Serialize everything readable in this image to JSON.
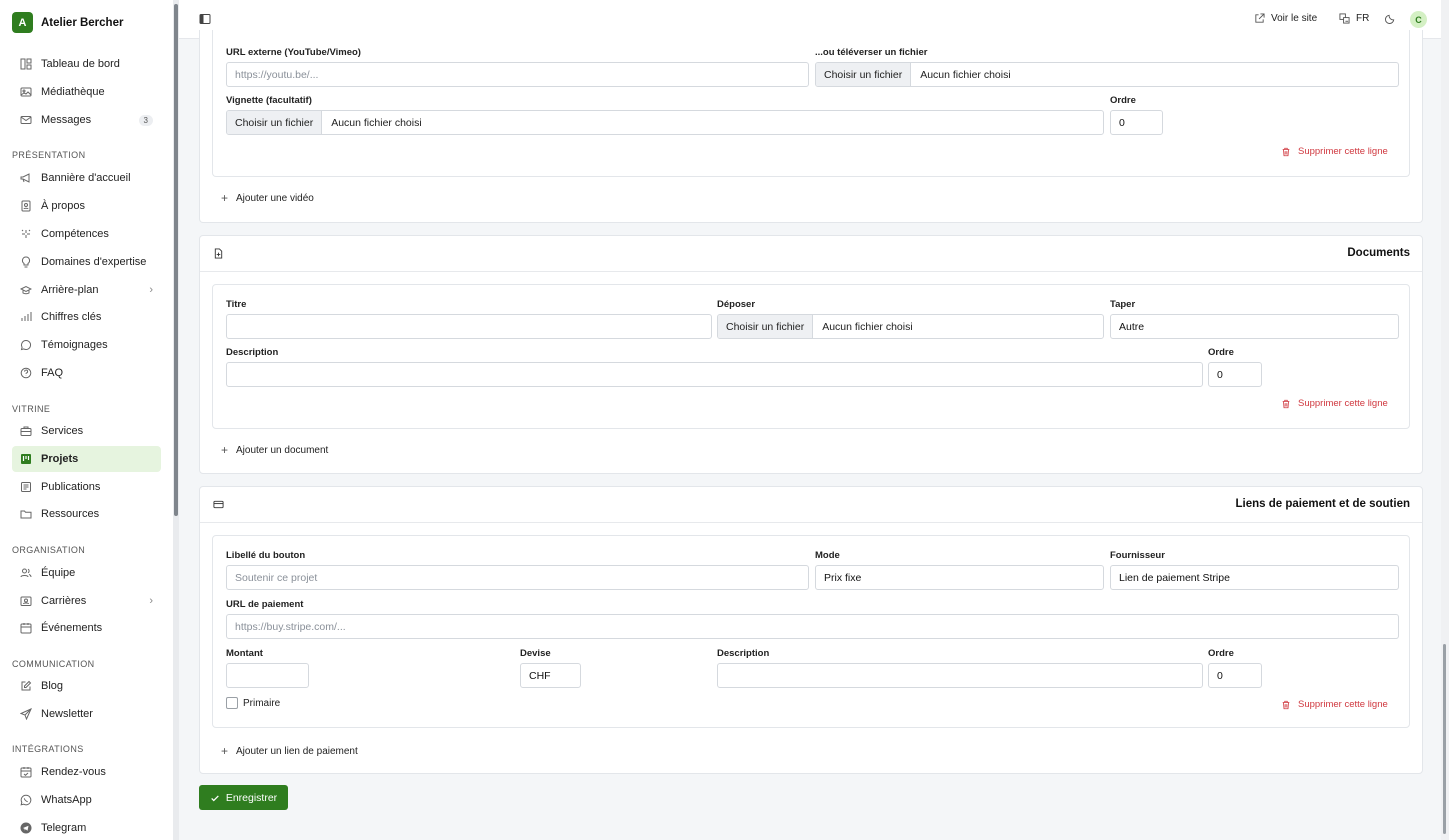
{
  "app": {
    "logo_letter": "A",
    "name": "Atelier Bercher"
  },
  "sidebar": {
    "top_items": [
      {
        "label": "Tableau de bord",
        "icon": "dashboard-icon"
      },
      {
        "label": "Médiathèque",
        "icon": "image-icon"
      },
      {
        "label": "Messages",
        "icon": "mail-icon",
        "badge": "3"
      }
    ],
    "sections": [
      {
        "title": "PRÉSENTATION",
        "items": [
          {
            "label": "Bannière d'accueil",
            "icon": "megaphone-icon"
          },
          {
            "label": "À propos",
            "icon": "user-card-icon"
          },
          {
            "label": "Compétences",
            "icon": "sparkles-icon"
          },
          {
            "label": "Domaines d'expertise",
            "icon": "lightbulb-icon"
          },
          {
            "label": "Arrière-plan",
            "icon": "graduation-cap-icon",
            "has_submenu": true
          },
          {
            "label": "Chiffres clés",
            "icon": "bar-chart-icon"
          },
          {
            "label": "Témoignages",
            "icon": "message-circle-icon"
          },
          {
            "label": "FAQ",
            "icon": "help-circle-icon"
          }
        ]
      },
      {
        "title": "VITRINE",
        "items": [
          {
            "label": "Services",
            "icon": "briefcase-icon"
          },
          {
            "label": "Projets",
            "icon": "kanban-icon",
            "active": true
          },
          {
            "label": "Publications",
            "icon": "newspaper-icon"
          },
          {
            "label": "Ressources",
            "icon": "folder-icon"
          }
        ]
      },
      {
        "title": "ORGANISATION",
        "items": [
          {
            "label": "Équipe",
            "icon": "users-icon"
          },
          {
            "label": "Carrières",
            "icon": "id-badge-icon",
            "has_submenu": true
          },
          {
            "label": "Événements",
            "icon": "calendar-icon"
          }
        ]
      },
      {
        "title": "COMMUNICATION",
        "items": [
          {
            "label": "Blog",
            "icon": "edit-icon"
          },
          {
            "label": "Newsletter",
            "icon": "send-icon"
          }
        ]
      },
      {
        "title": "INTÉGRATIONS",
        "items": [
          {
            "label": "Rendez-vous",
            "icon": "calendar-check-icon"
          },
          {
            "label": "WhatsApp",
            "icon": "whatsapp-icon"
          },
          {
            "label": "Telegram",
            "icon": "telegram-icon"
          }
        ]
      }
    ]
  },
  "topbar": {
    "view_site": "Voir le site",
    "language": "FR",
    "avatar_letter": "C"
  },
  "videos": {
    "external_url_label": "URL externe (YouTube/Vimeo)",
    "external_url_placeholder": "https://youtu.be/...",
    "upload_label": "...ou téléverser un fichier",
    "file_button": "Choisir un fichier",
    "no_file": "Aucun fichier choisi",
    "thumbnail_label": "Vignette (facultatif)",
    "order_label": "Ordre",
    "order_value": "0",
    "delete_row": "Supprimer cette ligne",
    "add_label": "Ajouter une vidéo"
  },
  "documents": {
    "title": "Documents",
    "title_label": "Titre",
    "title_value": "",
    "deposit_label": "Déposer",
    "file_button": "Choisir un fichier",
    "no_file": "Aucun fichier choisi",
    "type_label": "Taper",
    "type_value": "Autre",
    "description_label": "Description",
    "description_value": "",
    "order_label": "Ordre",
    "order_value": "0",
    "delete_row": "Supprimer cette ligne",
    "add_label": "Ajouter un document"
  },
  "payments": {
    "title": "Liens de paiement et de soutien",
    "button_label_label": "Libellé du bouton",
    "button_label_placeholder": "Soutenir ce projet",
    "mode_label": "Mode",
    "mode_value": "Prix fixe",
    "provider_label": "Fournisseur",
    "provider_value": "Lien de paiement Stripe",
    "url_label": "URL de paiement",
    "url_placeholder": "https://buy.stripe.com/...",
    "amount_label": "Montant",
    "amount_value": "",
    "currency_label": "Devise",
    "currency_value": "CHF",
    "description_label": "Description",
    "description_value": "",
    "order_label": "Ordre",
    "order_value": "0",
    "primary_label": "Primaire",
    "primary_checked": false,
    "delete_row": "Supprimer cette ligne",
    "add_label": "Ajouter un lien de paiement"
  },
  "save_button": "Enregistrer",
  "colors": {
    "brand": "#2f7d1f",
    "active_bg": "#e6f4df",
    "danger": "#d0383f"
  }
}
